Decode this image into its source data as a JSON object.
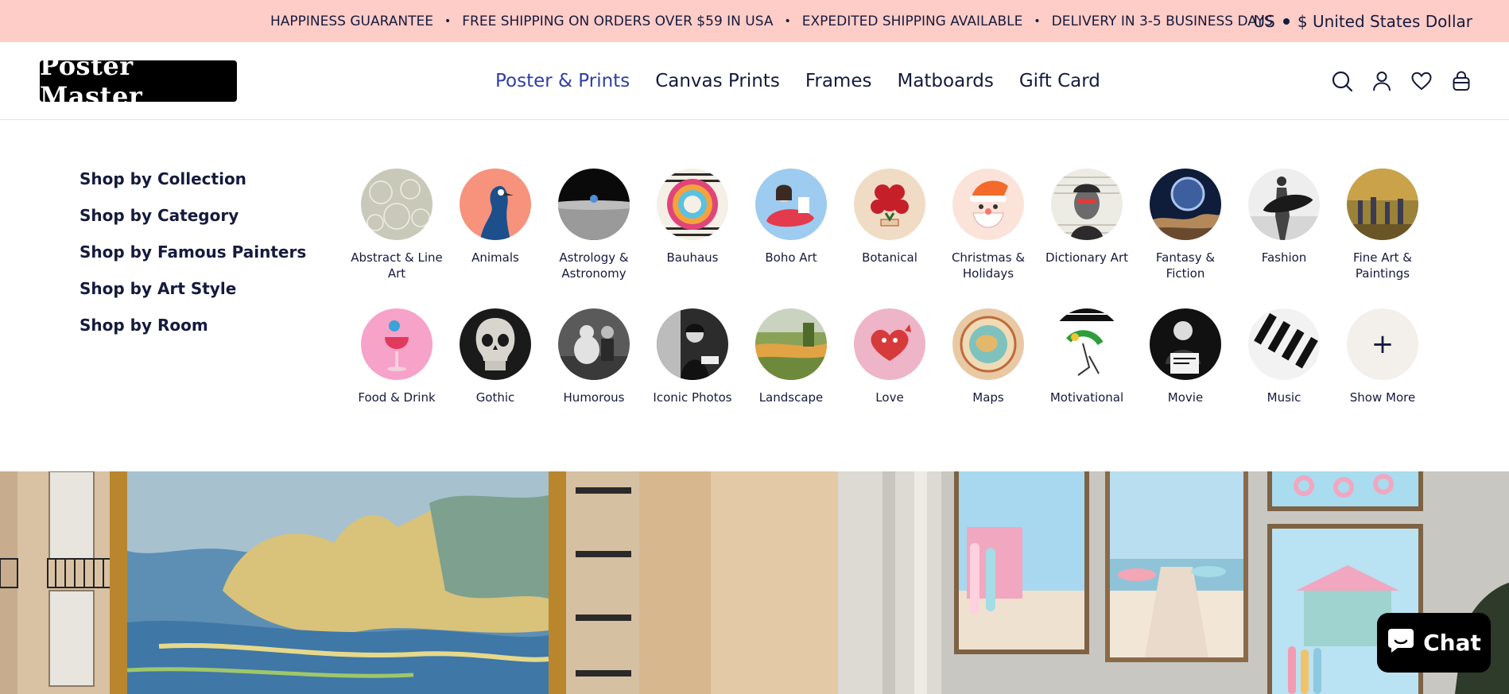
{
  "announcement": {
    "items": [
      "HAPPINESS GUARANTEE",
      "FREE SHIPPING ON ORDERS OVER $59 IN USA",
      "EXPEDITED SHIPPING AVAILABLE",
      "DELIVERY IN 3-5 BUSINESS DAYS"
    ],
    "separator": "•",
    "country": "US",
    "currency": "$ United States Dollar"
  },
  "header": {
    "logo": "Poster Master",
    "nav": [
      {
        "label": "Poster & Prints",
        "active": true
      },
      {
        "label": "Canvas Prints",
        "active": false
      },
      {
        "label": "Frames",
        "active": false
      },
      {
        "label": "Matboards",
        "active": false
      },
      {
        "label": "Gift Card",
        "active": false
      }
    ],
    "icons": [
      "search-icon",
      "account-icon",
      "wishlist-heart-icon",
      "cart-bag-icon"
    ]
  },
  "mega_menu": {
    "side_links": [
      "Shop by Collection",
      "Shop by Category",
      "Shop by Famous Painters",
      "Shop by Art Style",
      "Shop by Room"
    ],
    "categories": [
      {
        "label": "Abstract & Line Art",
        "thumb": "abstract",
        "colors": [
          "#c9c9b9",
          "#e8e6da"
        ]
      },
      {
        "label": "Animals",
        "thumb": "animals",
        "colors": [
          "#f7937c",
          "#1c4f8c"
        ]
      },
      {
        "label": "Astrology & Astronomy",
        "thumb": "astro",
        "colors": [
          "#0a0a0a",
          "#9a9a9a"
        ]
      },
      {
        "label": "Bauhaus",
        "thumb": "bauhaus",
        "colors": [
          "#e0457a",
          "#2a2a2a"
        ]
      },
      {
        "label": "Boho Art",
        "thumb": "boho",
        "colors": [
          "#9ecbf0",
          "#e43a4d"
        ]
      },
      {
        "label": "Botanical",
        "thumb": "botanical",
        "colors": [
          "#f0dcc4",
          "#c5202a"
        ]
      },
      {
        "label": "Christmas & Holidays",
        "thumb": "christmas",
        "colors": [
          "#fbe3da",
          "#f36a2a"
        ]
      },
      {
        "label": "Dictionary Art",
        "thumb": "dictionary",
        "colors": [
          "#ecebe4",
          "#2b2b2b"
        ]
      },
      {
        "label": "Fantasy & Fiction",
        "thumb": "fantasy",
        "colors": [
          "#0f1c3a",
          "#8aa7d6"
        ]
      },
      {
        "label": "Fashion",
        "thumb": "fashion",
        "colors": [
          "#eeeeee",
          "#222222"
        ]
      },
      {
        "label": "Fine Art & Paintings",
        "thumb": "fineart",
        "colors": [
          "#9a8238",
          "#3c3b52"
        ]
      },
      {
        "label": "Food & Drink",
        "thumb": "food",
        "colors": [
          "#f7a2c9",
          "#e23a5c"
        ]
      },
      {
        "label": "Gothic",
        "thumb": "gothic",
        "colors": [
          "#1a1a1a",
          "#d8d5cf"
        ]
      },
      {
        "label": "Humorous",
        "thumb": "humorous",
        "colors": [
          "#5a5a5a",
          "#e2e2e2"
        ]
      },
      {
        "label": "Iconic Photos",
        "thumb": "iconic",
        "colors": [
          "#2c2c2c",
          "#d9d9d9"
        ]
      },
      {
        "label": "Landscape",
        "thumb": "landscape",
        "colors": [
          "#8aa158",
          "#e2a344"
        ]
      },
      {
        "label": "Love",
        "thumb": "love",
        "colors": [
          "#eeb4c7",
          "#d63a3a"
        ]
      },
      {
        "label": "Maps",
        "thumb": "maps",
        "colors": [
          "#e8c9a4",
          "#4aa3a0"
        ]
      },
      {
        "label": "Motivational",
        "thumb": "motivational",
        "colors": [
          "#ffffff",
          "#2f9e3a"
        ]
      },
      {
        "label": "Movie",
        "thumb": "movie",
        "colors": [
          "#111111",
          "#dcdcdc"
        ]
      },
      {
        "label": "Music",
        "thumb": "music",
        "colors": [
          "#f2f2f2",
          "#111111"
        ]
      },
      {
        "label": "Show More",
        "thumb": "plus",
        "colors": [
          "#f3efea",
          "#151a3d"
        ]
      }
    ],
    "plus_glyph": "+"
  },
  "chat": {
    "label": "Chat"
  }
}
